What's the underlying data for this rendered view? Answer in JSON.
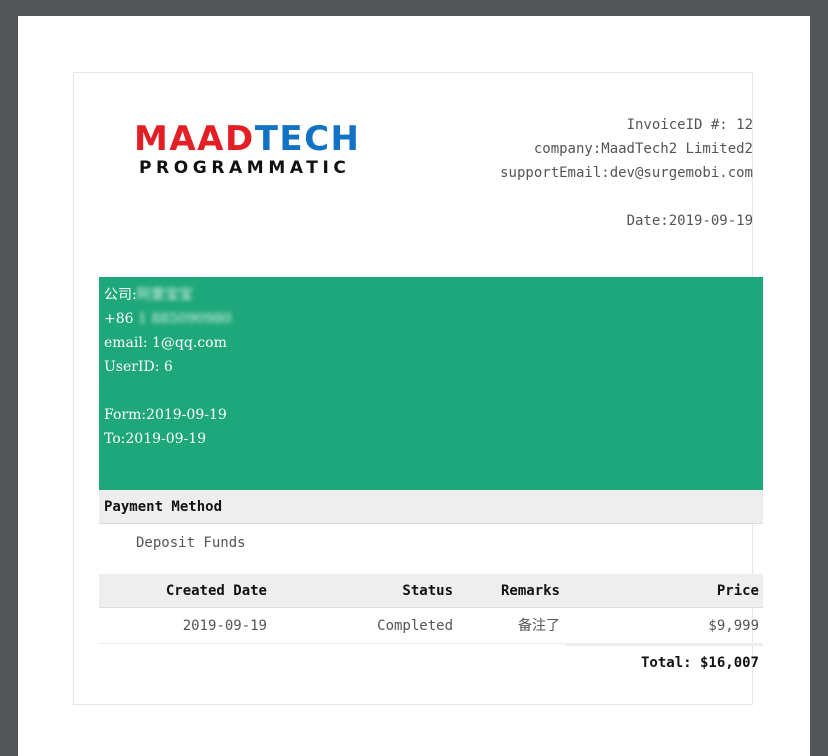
{
  "logo": {
    "word_a": "MAAD",
    "word_b": "TECH",
    "tagline": "PROGRAMMATIC",
    "colors": {
      "maad": "#e31e24",
      "tech": "#1273c5"
    }
  },
  "invoice": {
    "id_line": "InvoiceID #: 12",
    "company_line": "company:MaadTech2 Limited2",
    "support_line": "supportEmail:dev@surgemobi.com",
    "date_line": "Date:2019-09-19"
  },
  "client": {
    "company_label": "公司:",
    "company_value": "阿里宝宝",
    "phone_prefix": "+86 ",
    "phone_value": "1 885090980",
    "email_line": "email: 1@qq.com",
    "userid_line": "UserID: 6",
    "from_line": "Form:2019-09-19",
    "to_line": "To:2019-09-19",
    "bg_color": "#1ea77a"
  },
  "payment": {
    "heading": "Payment Method",
    "method": "Deposit Funds"
  },
  "table": {
    "headers": {
      "created_date": "Created Date",
      "status": "Status",
      "remarks": "Remarks",
      "price": "Price"
    },
    "rows": [
      {
        "created_date": "2019-09-19",
        "status": "Completed",
        "remarks": "备注了",
        "price": "$9,999"
      }
    ]
  },
  "total": "Total: $16,007"
}
